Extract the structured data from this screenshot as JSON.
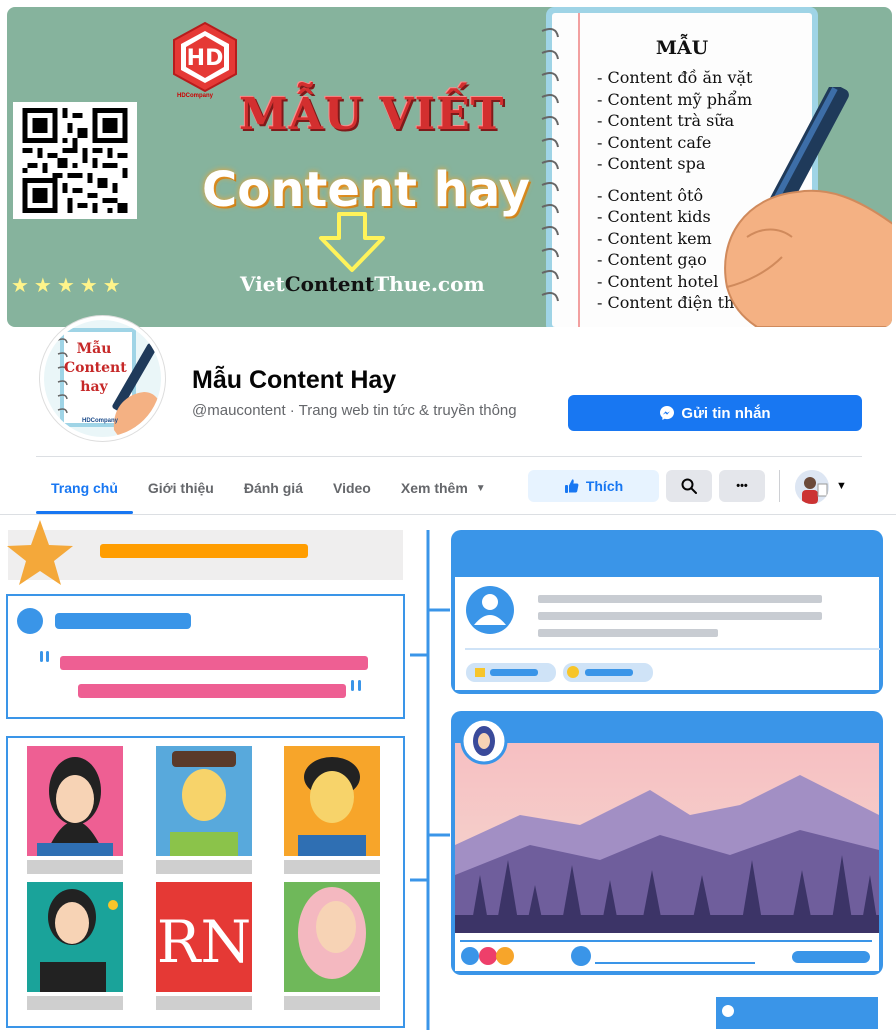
{
  "cover": {
    "logo_text": "HD",
    "logo_subtext": "HDCompany",
    "headline": "MẪU VIẾT",
    "subheadline": "Content hay",
    "site_url_prefix": "Viet",
    "site_url_middle": "Content",
    "site_url_suffix": "Thue.com",
    "stars": "★★★★★",
    "notepad": {
      "title": "MẪU",
      "items": [
        "- Content đồ ăn vặt",
        "- Content mỹ phẩm",
        "- Content trà sữa",
        "- Content cafe",
        "- Content spa",
        "- Content ôtô",
        "- Content kids",
        "- Content kem",
        "- Content gạo",
        "- Content hotel",
        "- Content điện thoại"
      ]
    }
  },
  "profile": {
    "avatar_text": "Mẫu Content hay",
    "avatar_subtext": "HDCompany",
    "name": "Mẫu Content Hay",
    "handle": "@maucontent · Trang web tin tức & truyền thông",
    "message_button": "Gửi tin nhắn"
  },
  "nav": {
    "tabs": [
      {
        "label": "Trang chủ"
      },
      {
        "label": "Giới thiệu"
      },
      {
        "label": "Đánh giá"
      },
      {
        "label": "Video"
      },
      {
        "label": "Xem thêm"
      }
    ],
    "like_button": "Thích",
    "more_glyph": "•••"
  },
  "colors": {
    "brand_blue": "#1877f2",
    "cover_green": "#86b39d",
    "illus_blue": "#3a95e8",
    "pink_bar": "#ee5f93",
    "orange": "#ffa000"
  }
}
